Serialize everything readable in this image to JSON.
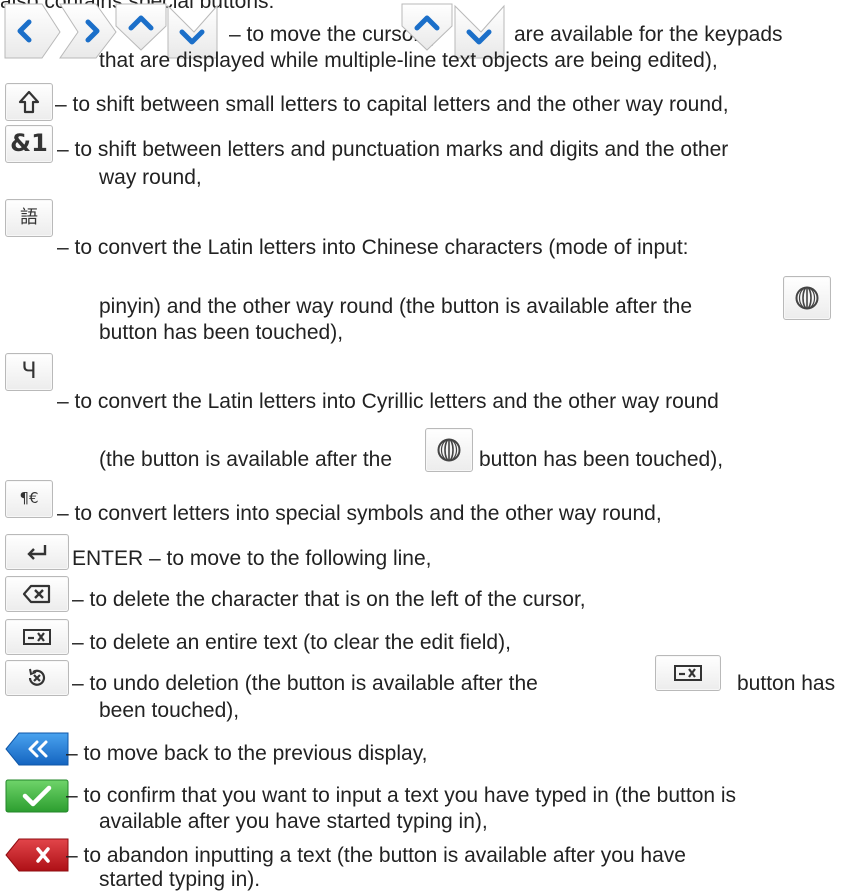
{
  "intro_fragment": "also contains special buttons:",
  "items": [
    {
      "icon": "arrow-keys",
      "text_pre": "–  to move the cursor (",
      "text_post": "are available for the keypads",
      "text_cont": "that are displayed while multiple-line text objects are being edited),"
    },
    {
      "icon": "shift-icon",
      "text": "– to shift between small letters to capital letters and the other way round,"
    },
    {
      "icon": "symbols-icon",
      "key_label": "&1",
      "text": "– to shift between letters and punctuation marks and digits and the other",
      "text_cont": "way round,"
    },
    {
      "icon": "chinese-icon",
      "key_label": "語",
      "text": "– to convert the Latin letters into Chinese characters (mode of input:",
      "text_cont_pre": "pinyin) and the other way round (the button is available after the",
      "text_cont2": "button has been touched),"
    },
    {
      "icon": "cyrillic-icon",
      "key_label": "Ч",
      "text": "– to convert the Latin letters into Cyrillic letters and the other way round",
      "text_cont_pre": "(the button is available after the",
      "text_cont_post": "button has been touched),"
    },
    {
      "icon": "special-symbols-icon",
      "key_label": "¶€",
      "text": "– to convert letters into special symbols and the other way round,"
    },
    {
      "icon": "enter-icon",
      "text": "ENTER – to move to the following line,"
    },
    {
      "icon": "backspace-icon",
      "text": "– to delete the character that is on the left of the cursor,"
    },
    {
      "icon": "clear-field-icon",
      "text": "– to delete an entire text (to clear the edit field),"
    },
    {
      "icon": "undo-delete-icon",
      "text_pre": "– to undo deletion (the button is available after the",
      "text_post": "button has",
      "text_cont": "been touched),"
    },
    {
      "icon": "back-icon",
      "text": "– to move back to the previous display,"
    },
    {
      "icon": "confirm-icon",
      "text": "– to confirm that you want to input a text you have typed in (the button is",
      "text_cont": "available after you have started typing in),"
    },
    {
      "icon": "abandon-icon",
      "text": "– to abandon inputting a text (the button is available after you have",
      "text_cont": "started typing in)."
    }
  ],
  "colors": {
    "key_border": "#b9b9b9",
    "nav_blue": "#1a78d6",
    "confirm_green": "#3bb53b",
    "abandon_red": "#c8161d"
  }
}
